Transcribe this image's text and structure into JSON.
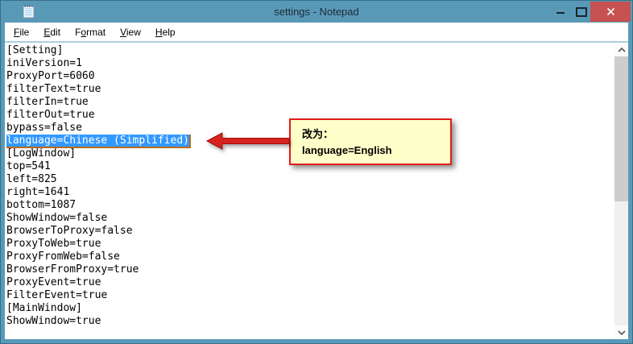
{
  "window": {
    "title": "settings - Notepad"
  },
  "menu": {
    "items": [
      {
        "label": "File",
        "pre": "",
        "key": "F",
        "post": "ile"
      },
      {
        "label": "Edit",
        "pre": "",
        "key": "E",
        "post": "dit"
      },
      {
        "label": "Format",
        "pre": "F",
        "key": "o",
        "post": "rmat"
      },
      {
        "label": "View",
        "pre": "",
        "key": "V",
        "post": "iew"
      },
      {
        "label": "Help",
        "pre": "",
        "key": "H",
        "post": "elp"
      }
    ]
  },
  "editor": {
    "selected_index": 7,
    "lines": [
      "[Setting]",
      "iniVersion=1",
      "ProxyPort=6060",
      "filterText=true",
      "filterIn=true",
      "filterOut=true",
      "bypass=false",
      "language=Chinese (Simplified)",
      "[LogWindow]",
      "top=541",
      "left=825",
      "right=1641",
      "bottom=1087",
      "ShowWindow=false",
      "BrowserToProxy=false",
      "ProxyToWeb=true",
      "ProxyFromWeb=false",
      "BrowserFromProxy=true",
      "ProxyEvent=true",
      "FilterEvent=true",
      "[MainWindow]",
      "ShowWindow=true"
    ]
  },
  "annotation": {
    "line1": "改为：",
    "line2": "language=English"
  },
  "icons": {
    "notepad": "notepad-pad",
    "minimize": "–",
    "maximize": "□",
    "close": "✕",
    "scroll_up": "⌃",
    "scroll_down": "⌄",
    "arrow": "left-arrow"
  },
  "colors": {
    "titlebar": "#5999b8",
    "selection_bg": "#3399ff",
    "selection_outline": "#bc6a1c",
    "close_button": "#c75050",
    "annotation_bg": "#ffffc9",
    "annotation_border": "#e01b1b",
    "arrow": "#d6231d"
  }
}
